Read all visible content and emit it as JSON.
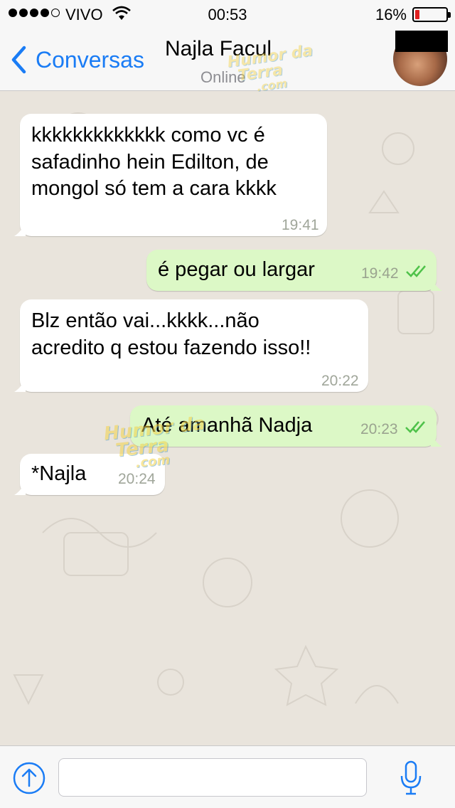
{
  "status_bar": {
    "carrier": "VIVO",
    "time": "00:53",
    "battery": "16%",
    "signal_bars": 4,
    "battery_level": 0.16
  },
  "nav": {
    "back_label": "Conversas",
    "contact_name": "Najla Facul",
    "contact_status": "Online"
  },
  "messages": [
    {
      "direction": "in",
      "text": "kkkkkkkkkkkkk como vc é\nsafadinho hein Edilton, de\nmongol só tem a cara kkkk",
      "time": "19:41"
    },
    {
      "direction": "out",
      "text": "é pegar ou largar",
      "time": "19:42",
      "read": true
    },
    {
      "direction": "in",
      "text": "Blz então vai...kkkk...não\nacredito q estou fazendo isso!!",
      "time": "20:22"
    },
    {
      "direction": "out",
      "text": "Até amanhã Nadja",
      "time": "20:23",
      "read": true
    },
    {
      "direction": "in",
      "text": "*Najla",
      "time": "20:24"
    }
  ],
  "watermarks": [
    {
      "line1": "Humor da",
      "line2": "Terra",
      "line3": ".com"
    }
  ],
  "input": {
    "placeholder": ""
  },
  "colors": {
    "accent": "#1a7cf5",
    "outgoing_bubble": "#dcf8c6",
    "incoming_bubble": "#ffffff",
    "read_ticks": "#4fc24a",
    "chat_background": "#e9e4dc"
  },
  "icons": {
    "back": "chevron-left-icon",
    "wifi": "wifi-icon",
    "attach": "upload-arrow-icon",
    "mic": "microphone-icon",
    "ticks": "double-check-icon"
  }
}
